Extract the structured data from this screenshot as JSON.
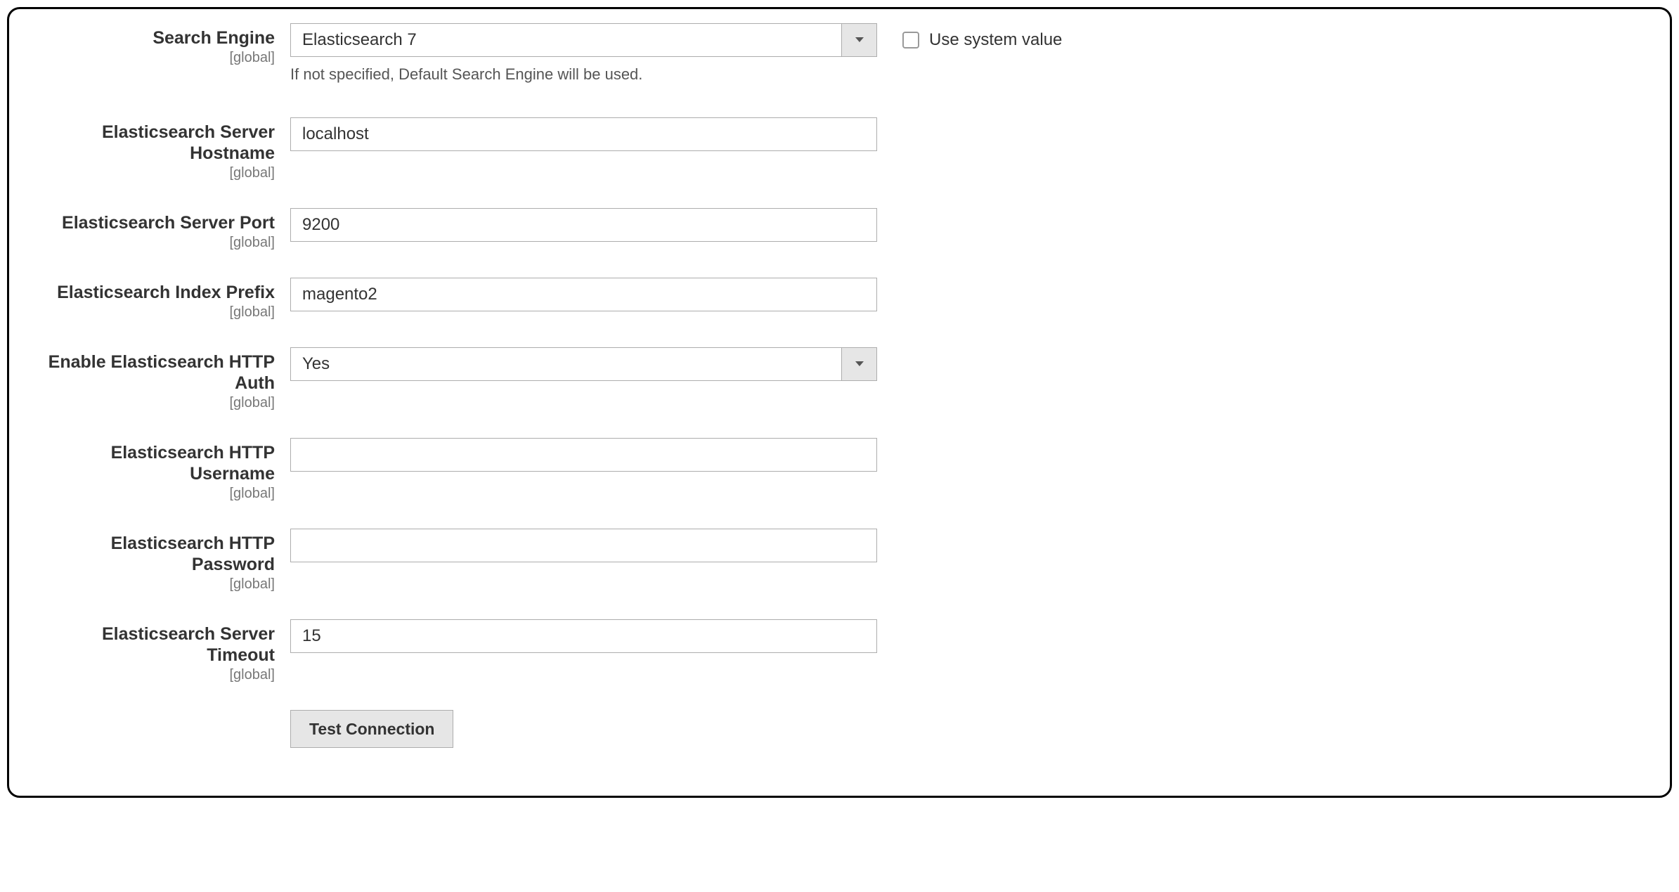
{
  "scope_text": "[global]",
  "fields": {
    "search_engine": {
      "label": "Search Engine",
      "value": "Elasticsearch 7",
      "note": "If not specified, Default Search Engine will be used."
    },
    "es_hostname": {
      "label": "Elasticsearch Server Hostname",
      "value": "localhost"
    },
    "es_port": {
      "label": "Elasticsearch Server Port",
      "value": "9200"
    },
    "es_index_prefix": {
      "label": "Elasticsearch Index Prefix",
      "value": "magento2"
    },
    "es_http_auth": {
      "label": "Enable Elasticsearch HTTP Auth",
      "value": "Yes"
    },
    "es_http_username": {
      "label": "Elasticsearch HTTP Username",
      "value": ""
    },
    "es_http_password": {
      "label": "Elasticsearch HTTP Password",
      "value": ""
    },
    "es_timeout": {
      "label": "Elasticsearch Server Timeout",
      "value": "15"
    }
  },
  "use_system_value_label": "Use system value",
  "test_connection_label": "Test Connection"
}
